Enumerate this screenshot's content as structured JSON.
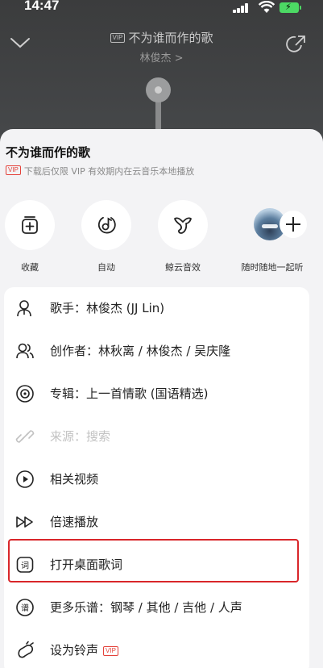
{
  "status_bar": {
    "time": "14:47",
    "battery_icon": "charging-battery-icon"
  },
  "player": {
    "vip_badge": "VIP",
    "song_title": "不为谁而作的歌",
    "artist": "林俊杰 >"
  },
  "sheet": {
    "title": "不为谁而作的歌",
    "vip_badge": "VIP",
    "subtitle": "下载后仅限 VIP 有效期内在云音乐本地播放",
    "actions": [
      {
        "label": "收藏",
        "icon": "add-to-playlist-icon"
      },
      {
        "label": "自动",
        "icon": "auto-mode-icon"
      },
      {
        "label": "鲸云音效",
        "icon": "whale-audio-icon"
      },
      {
        "label": "随时随地一起听",
        "icon": "listen-together-icon"
      }
    ],
    "items": [
      {
        "label": "歌手：林俊杰 (JJ Lin)",
        "icon": "singer-icon",
        "enabled": true
      },
      {
        "label": "创作者：林秋离 / 林俊杰 / 吴庆隆",
        "icon": "creators-icon",
        "enabled": true
      },
      {
        "label": "专辑：上一首情歌 (国语精选)",
        "icon": "album-disc-icon",
        "enabled": true
      },
      {
        "label": "来源：搜索",
        "icon": "source-link-icon",
        "enabled": false
      },
      {
        "label": "相关视频",
        "icon": "video-play-icon",
        "enabled": true
      },
      {
        "label": "倍速播放",
        "icon": "playback-speed-icon",
        "enabled": true
      },
      {
        "label": "打开桌面歌词",
        "icon": "desktop-lyrics-icon",
        "enabled": true,
        "highlighted": true
      },
      {
        "label": "更多乐谱：钢琴 / 其他 / 吉他 / 人声",
        "icon": "sheet-music-icon",
        "enabled": true
      },
      {
        "label": "设为铃声",
        "icon": "ringtone-icon",
        "enabled": true,
        "vip_badge": "VIP"
      }
    ]
  },
  "colors": {
    "highlight_border": "#d9262a",
    "vip_red": "#e4423b"
  }
}
